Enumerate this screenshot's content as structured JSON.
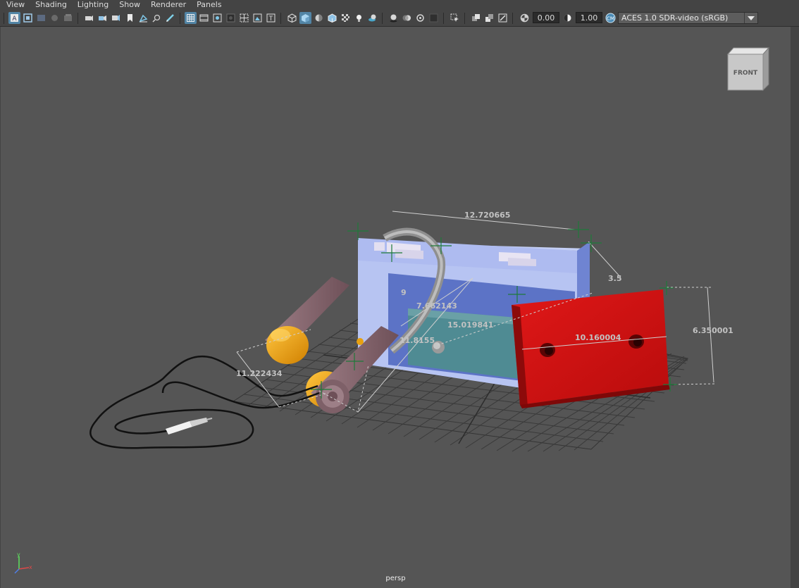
{
  "menu": [
    "View",
    "Shading",
    "Lighting",
    "Show",
    "Renderer",
    "Panels"
  ],
  "toolbar": {
    "exposure": "0.00",
    "gamma": "1.00",
    "color_management": "ACES 1.0 SDR-video (sRGB)",
    "active_color": "#5285a6"
  },
  "viewport": {
    "camera": "persp",
    "view_cube_face": "FRONT",
    "background": "#555555"
  },
  "measurements": {
    "player_width": "12.720665",
    "player_depth": "3.5",
    "player_diag": "7.662143",
    "player_height": "15.019841",
    "player_edge": "11.8155",
    "player_small": "9",
    "headphone_span": "11.222434",
    "cassette_width": "10.160004",
    "cassette_height": "6.350001"
  },
  "axis_labels": {
    "y": "y",
    "x": "x"
  },
  "colors": {
    "cassette": "#d01414",
    "player_body": "#9fb0e8",
    "player_face": "#5a73c4",
    "ear_cup": "#f0a000",
    "headphone_arm": "#8a6a72",
    "cable": "#111111"
  }
}
